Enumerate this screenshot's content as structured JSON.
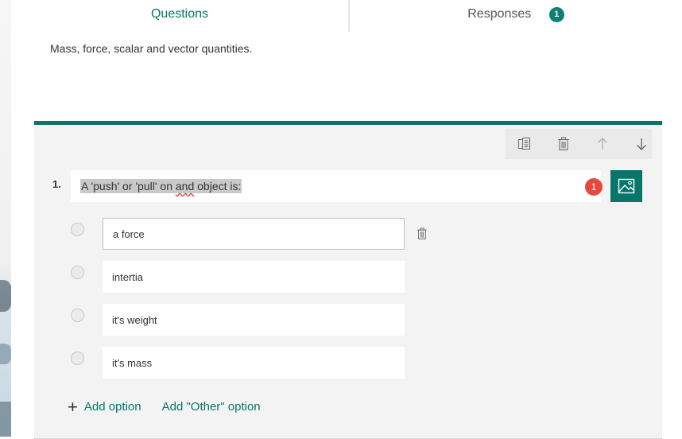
{
  "tabs": {
    "questions": "Questions",
    "responses": "Responses",
    "responses_count": "1"
  },
  "form": {
    "description": "Mass, force, scalar and vector quantities."
  },
  "question": {
    "number": "1.",
    "text_before": "A 'push' or 'pull' on ",
    "text_misspelled": "and",
    "text_after": " object is:",
    "error_count": "1",
    "options": [
      "a force",
      "intertia",
      "it's weight",
      "it's mass"
    ],
    "add_option": "Add option",
    "add_other_option": "Add \"Other\" option"
  },
  "colors": {
    "accent": "#077568",
    "error": "#e5483c"
  },
  "icons": {
    "copy": "copy-icon",
    "delete": "trash-icon",
    "move_up": "arrow-up-icon",
    "move_down": "arrow-down-icon",
    "insert_image": "image-icon",
    "add": "plus-icon"
  }
}
